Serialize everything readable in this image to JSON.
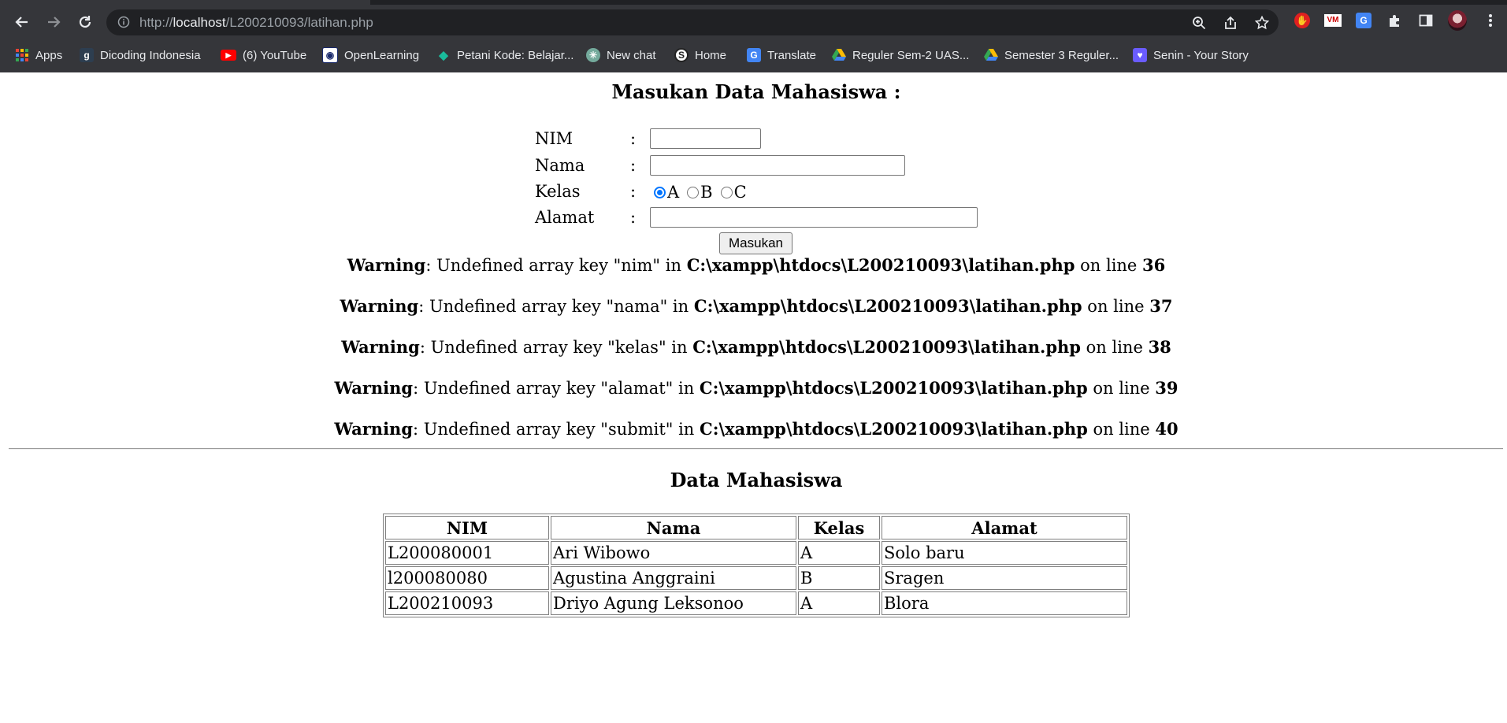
{
  "browser": {
    "url_prefix": "http://",
    "url_host": "localhost",
    "url_path": "/L200210093/latihan.php",
    "bookmarks": [
      {
        "label": "Apps",
        "icon": "apps-grid-icon"
      },
      {
        "label": "Dicoding Indonesia",
        "icon": "dicoding-icon"
      },
      {
        "label": "(6) YouTube",
        "icon": "youtube-icon"
      },
      {
        "label": "OpenLearning",
        "icon": "openlearning-icon"
      },
      {
        "label": "Petani Kode: Belajar...",
        "icon": "petanikode-icon"
      },
      {
        "label": "New chat",
        "icon": "chatgpt-icon"
      },
      {
        "label": "Home",
        "icon": "home-s-icon"
      },
      {
        "label": "Translate",
        "icon": "google-translate-icon"
      },
      {
        "label": "Reguler Sem-2 UAS...",
        "icon": "google-drive-icon"
      },
      {
        "label": "Semester 3 Reguler...",
        "icon": "google-drive-icon"
      },
      {
        "label": "Senin - Your Story",
        "icon": "heart-icon"
      }
    ]
  },
  "form": {
    "heading": "Masukan Data Mahasiswa :",
    "colon": ":",
    "nim_label": "NIM",
    "nama_label": "Nama",
    "kelas_label": "Kelas",
    "alamat_label": "Alamat",
    "kelas_options": [
      "A",
      "B",
      "C"
    ],
    "kelas_selected": "A",
    "submit_label": "Masukan"
  },
  "warnings": [
    {
      "label": "Warning",
      "message": ": Undefined array key \"nim\" in ",
      "file": "C:\\xampp\\htdocs\\L200210093\\latihan.php",
      "on_line": " on line ",
      "line": "36"
    },
    {
      "label": "Warning",
      "message": ": Undefined array key \"nama\" in ",
      "file": "C:\\xampp\\htdocs\\L200210093\\latihan.php",
      "on_line": " on line ",
      "line": "37"
    },
    {
      "label": "Warning",
      "message": ": Undefined array key \"kelas\" in ",
      "file": "C:\\xampp\\htdocs\\L200210093\\latihan.php",
      "on_line": " on line ",
      "line": "38"
    },
    {
      "label": "Warning",
      "message": ": Undefined array key \"alamat\" in ",
      "file": "C:\\xampp\\htdocs\\L200210093\\latihan.php",
      "on_line": " on line ",
      "line": "39"
    },
    {
      "label": "Warning",
      "message": ": Undefined array key \"submit\" in ",
      "file": "C:\\xampp\\htdocs\\L200210093\\latihan.php",
      "on_line": " on line ",
      "line": "40"
    }
  ],
  "table": {
    "heading": "Data Mahasiswa",
    "headers": [
      "NIM",
      "Nama",
      "Kelas",
      "Alamat"
    ],
    "rows": [
      [
        "L200080001",
        "Ari Wibowo",
        "A",
        "Solo baru"
      ],
      [
        "l200080080",
        "Agustina Anggraini",
        "B",
        "Sragen"
      ],
      [
        "L200210093",
        "Driyo Agung Leksonoo",
        "A",
        "Blora"
      ]
    ]
  },
  "colors": {
    "chrome_bg": "#35363a",
    "omnibox_bg": "#202124",
    "radio_accent": "#0075ff"
  }
}
